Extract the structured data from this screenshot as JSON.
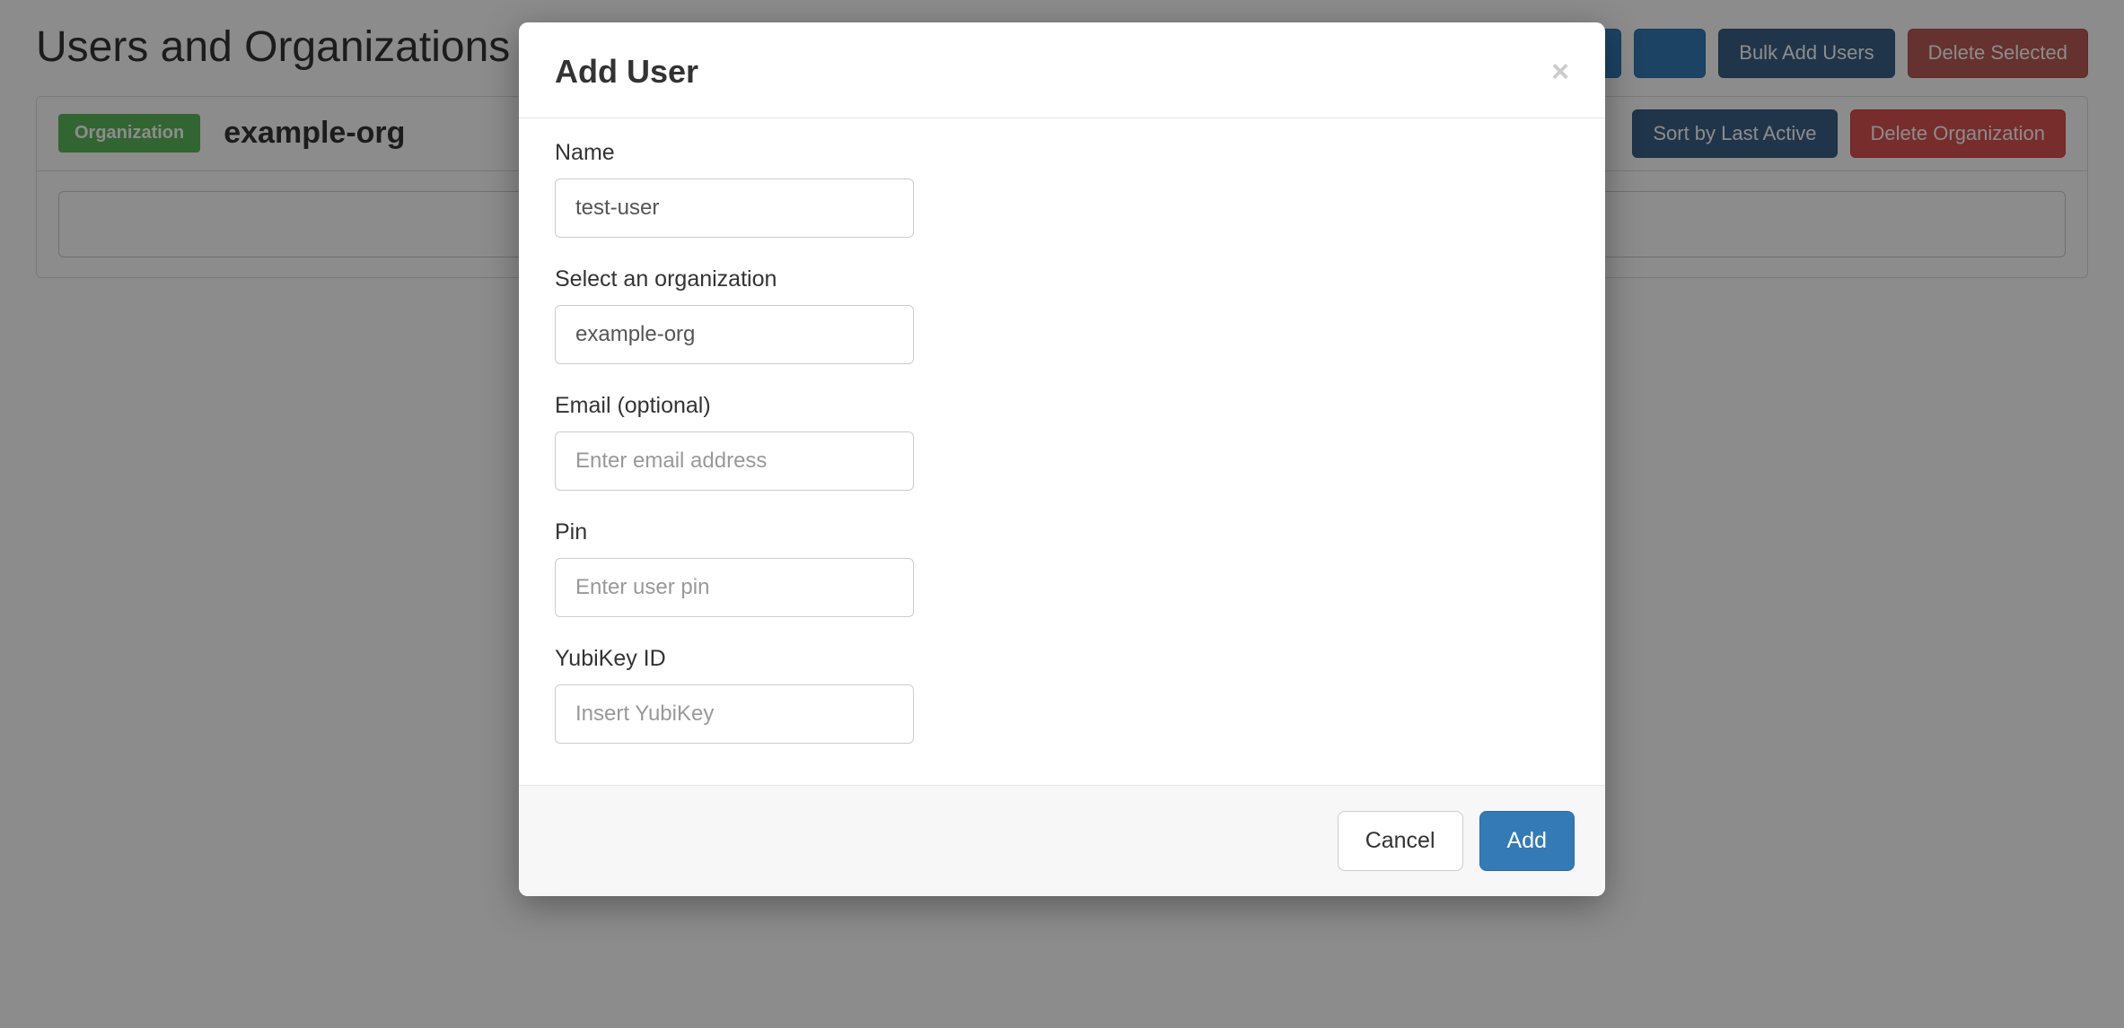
{
  "page": {
    "title": "Users and Organizations"
  },
  "header_buttons": {
    "bulk_add_users": "Bulk Add Users",
    "delete_selected": "Delete Selected"
  },
  "org_panel": {
    "badge": "Organization",
    "name": "example-org",
    "sort_button": "Sort by Last Active",
    "delete_button": "Delete Organization"
  },
  "modal": {
    "title": "Add User",
    "fields": {
      "name": {
        "label": "Name",
        "value": "test-user"
      },
      "organization": {
        "label": "Select an organization",
        "value": "example-org"
      },
      "email": {
        "label": "Email (optional)",
        "placeholder": "Enter email address"
      },
      "pin": {
        "label": "Pin",
        "placeholder": "Enter user pin"
      },
      "yubikey": {
        "label": "YubiKey ID",
        "placeholder": "Insert YubiKey"
      }
    },
    "buttons": {
      "cancel": "Cancel",
      "add": "Add"
    }
  }
}
